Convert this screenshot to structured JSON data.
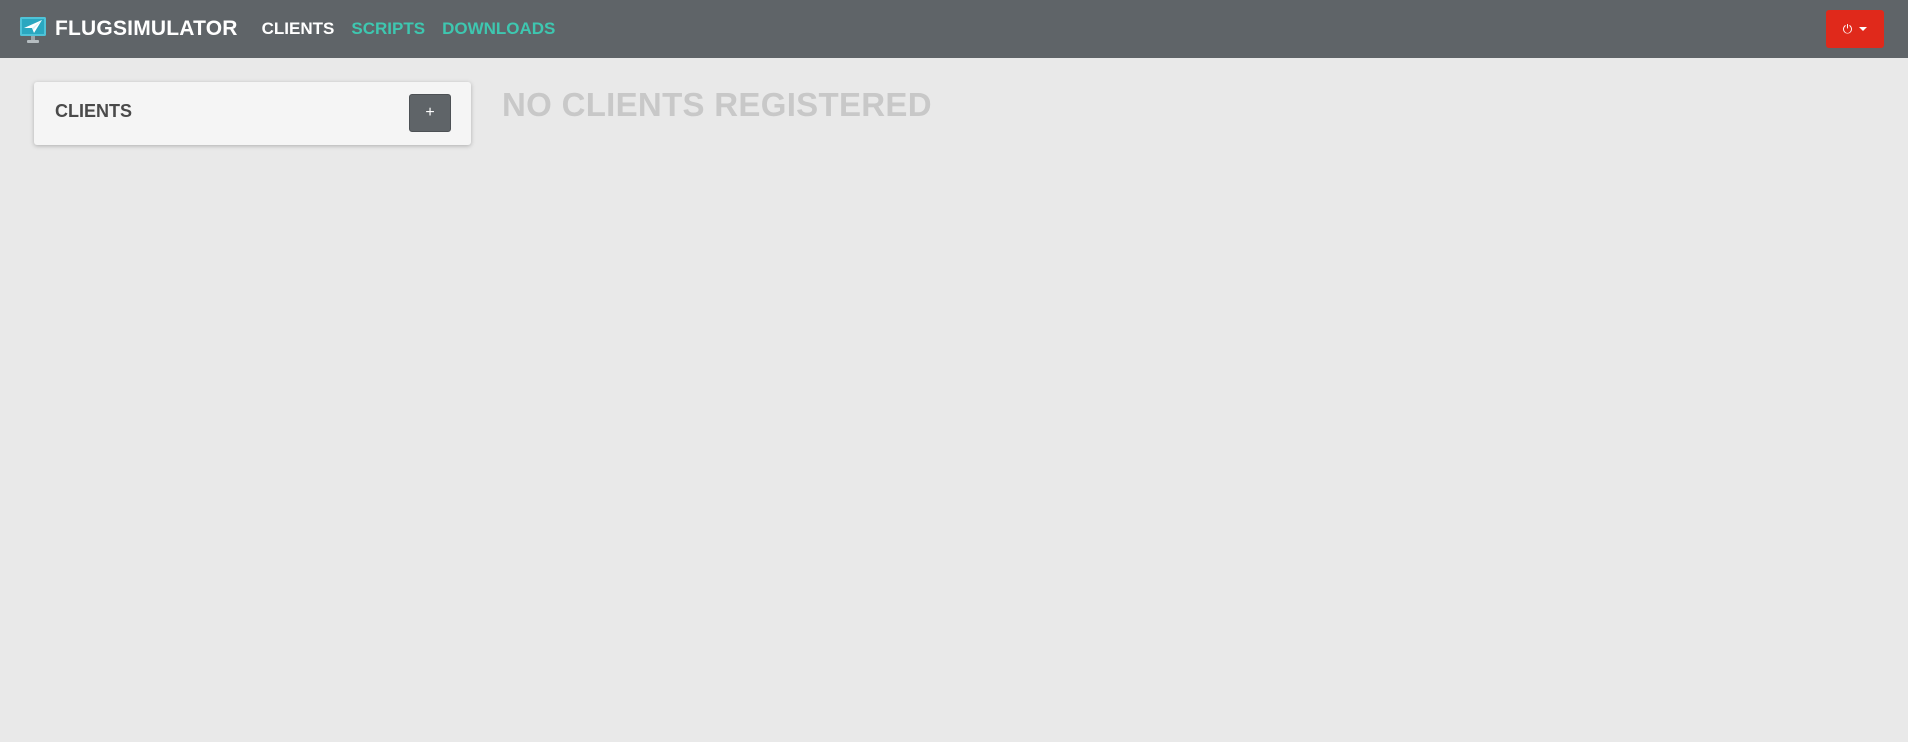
{
  "navbar": {
    "brand_icon": "paper-plane-monitor-icon",
    "brand_text": "FLUGSIMULATOR",
    "links": [
      {
        "label": "CLIENTS",
        "active": true
      },
      {
        "label": "SCRIPTS",
        "active": false
      },
      {
        "label": "DOWNLOADS",
        "active": false
      }
    ],
    "power_button": {
      "icon": "power-icon",
      "power_glyph": "⏻",
      "color": "#e0291b"
    }
  },
  "clients_panel": {
    "title": "CLIENTS",
    "add_label": "+"
  },
  "main": {
    "empty_message": "NO CLIENTS REGISTERED"
  },
  "colors": {
    "navbar_bg": "#5f6468",
    "accent_link": "#3ec7b0",
    "page_bg": "#e9e9e9",
    "danger": "#e0291b"
  }
}
